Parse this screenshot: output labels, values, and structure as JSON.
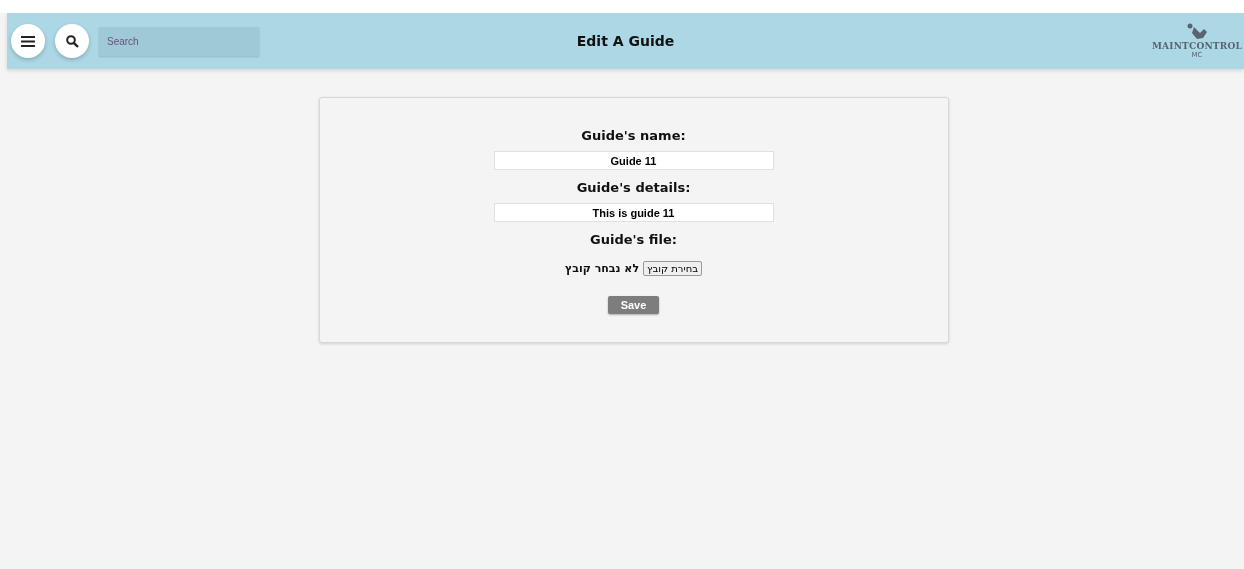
{
  "header": {
    "search": {
      "placeholder": "Search"
    },
    "title": "Edit A Guide",
    "logo": {
      "name": "MAINTCONTROL",
      "short": "MC"
    }
  },
  "form": {
    "fields": [
      {
        "kind": "text",
        "label": "Guide's name:",
        "value": "Guide 11"
      },
      {
        "kind": "text",
        "label": "Guide's details:",
        "value": "This is guide 11"
      },
      {
        "kind": "file",
        "label": "Guide's file:",
        "button": "בחירת קובץ",
        "status": "לא נבחר קובץ"
      }
    ],
    "save": "Save"
  }
}
